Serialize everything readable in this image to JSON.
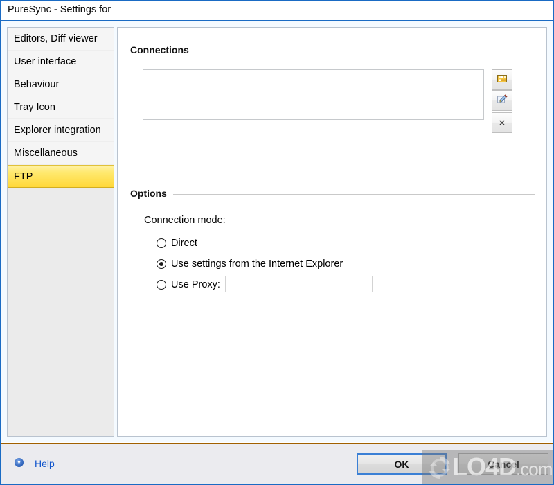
{
  "window": {
    "title": "PureSync - Settings for",
    "accent_border": "#1a6bc4"
  },
  "sidebar": {
    "items": [
      {
        "label": "Editors, Diff viewer",
        "selected": false
      },
      {
        "label": "User interface",
        "selected": false
      },
      {
        "label": "Behaviour",
        "selected": false
      },
      {
        "label": "Tray Icon",
        "selected": false
      },
      {
        "label": "Explorer integration",
        "selected": false
      },
      {
        "label": "Miscellaneous",
        "selected": false
      },
      {
        "label": "FTP",
        "selected": true
      }
    ],
    "selected_color": "#ffd83a"
  },
  "content": {
    "connections": {
      "group_label": "Connections",
      "list_items": [],
      "tools": [
        {
          "name": "new-connection-icon",
          "glyph": ""
        },
        {
          "name": "edit-connection-icon",
          "glyph": ""
        },
        {
          "name": "delete-connection-icon",
          "glyph": "✕"
        }
      ]
    },
    "options": {
      "group_label": "Options",
      "connection_mode_label": "Connection mode:",
      "radios": [
        {
          "label": "Direct",
          "checked": false
        },
        {
          "label": "Use settings from the Internet Explorer",
          "checked": true
        },
        {
          "label": "Use Proxy:",
          "checked": false
        }
      ],
      "proxy_field": {
        "value": "",
        "placeholder": ""
      }
    }
  },
  "footer": {
    "help_icon": "help-icon",
    "help_label": "Help",
    "ok_label": "OK",
    "cancel_label": "Cancel",
    "separator_color": "#a06000"
  },
  "watermark": {
    "text": "LO4D",
    "suffix": ".com",
    "logo": "circular-arrows-icon"
  }
}
